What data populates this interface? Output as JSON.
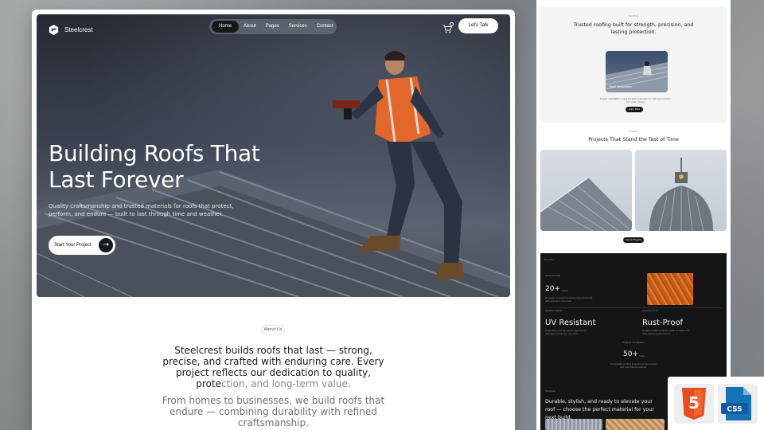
{
  "brand": {
    "name": "Steelcrest"
  },
  "nav": {
    "links": [
      "Home",
      "About",
      "Pages",
      "Services",
      "Contact"
    ],
    "cta": "Let's Talk"
  },
  "hero": {
    "title": "Building Roofs That Last Forever",
    "subtitle": "Quality craftsmanship and trusted materials for roofs that protect, perform, and endure — built to last through time and weather.",
    "cta": "Start Your Project"
  },
  "about": {
    "badge": "About Us",
    "text_main": "Steelcrest builds roofs that last — strong, precise, and crafted with enduring care. Every project reflects our dedication to quality, prote",
    "text_fade": "ction, and long-term value.",
    "text_secondary": "From homes to businesses, we build roofs that endure — combining durability with refined craftsmanship."
  },
  "side": {
    "section1": {
      "eyebrow": "Roofing",
      "title": "Trusted roofing built for strength, precision, and lasting protection.",
      "image_label": "Roof Installation",
      "desc": "Expert installation using durable materials for lasting protection and clean design.",
      "button": "Learn More"
    },
    "section2": {
      "eyebrow": "Projects",
      "title": "Projects That Stand the Test of Time",
      "button": "See All Projects"
    },
    "section3": {
      "tag": "Benefits",
      "stat1_label": "Years of Craft",
      "stat1_value": "20+",
      "stat1_unit": "Years",
      "stat1_desc": "Decades of expertise delivering roofs built with precision and care.",
      "uv_label": "Weather Ready",
      "uv_title": "UV Resistant",
      "uv_desc": "Protective coatings guard against sun damage and fading over time.",
      "rust_label": "Durable Finish",
      "rust_title": "Rust-Proof",
      "rust_desc": "Treated metal surfaces resist corrosion for long-lasting performance.",
      "stat2_label": "Projects Completed",
      "stat2_value": "50+",
      "stat2_unit": "Sites",
      "stat2_desc": "Completed roofing projects across homes and commercial spaces.",
      "foot_tag": "Materials",
      "foot_text": "Durable, stylish, and ready to elevate your roof — choose the perfect material for your next build."
    }
  },
  "badges": {
    "html": "HTML5",
    "css": "CSS"
  },
  "colors": {
    "dark": "#151719",
    "html_orange": "#e44d26",
    "css_blue": "#1572b6"
  }
}
